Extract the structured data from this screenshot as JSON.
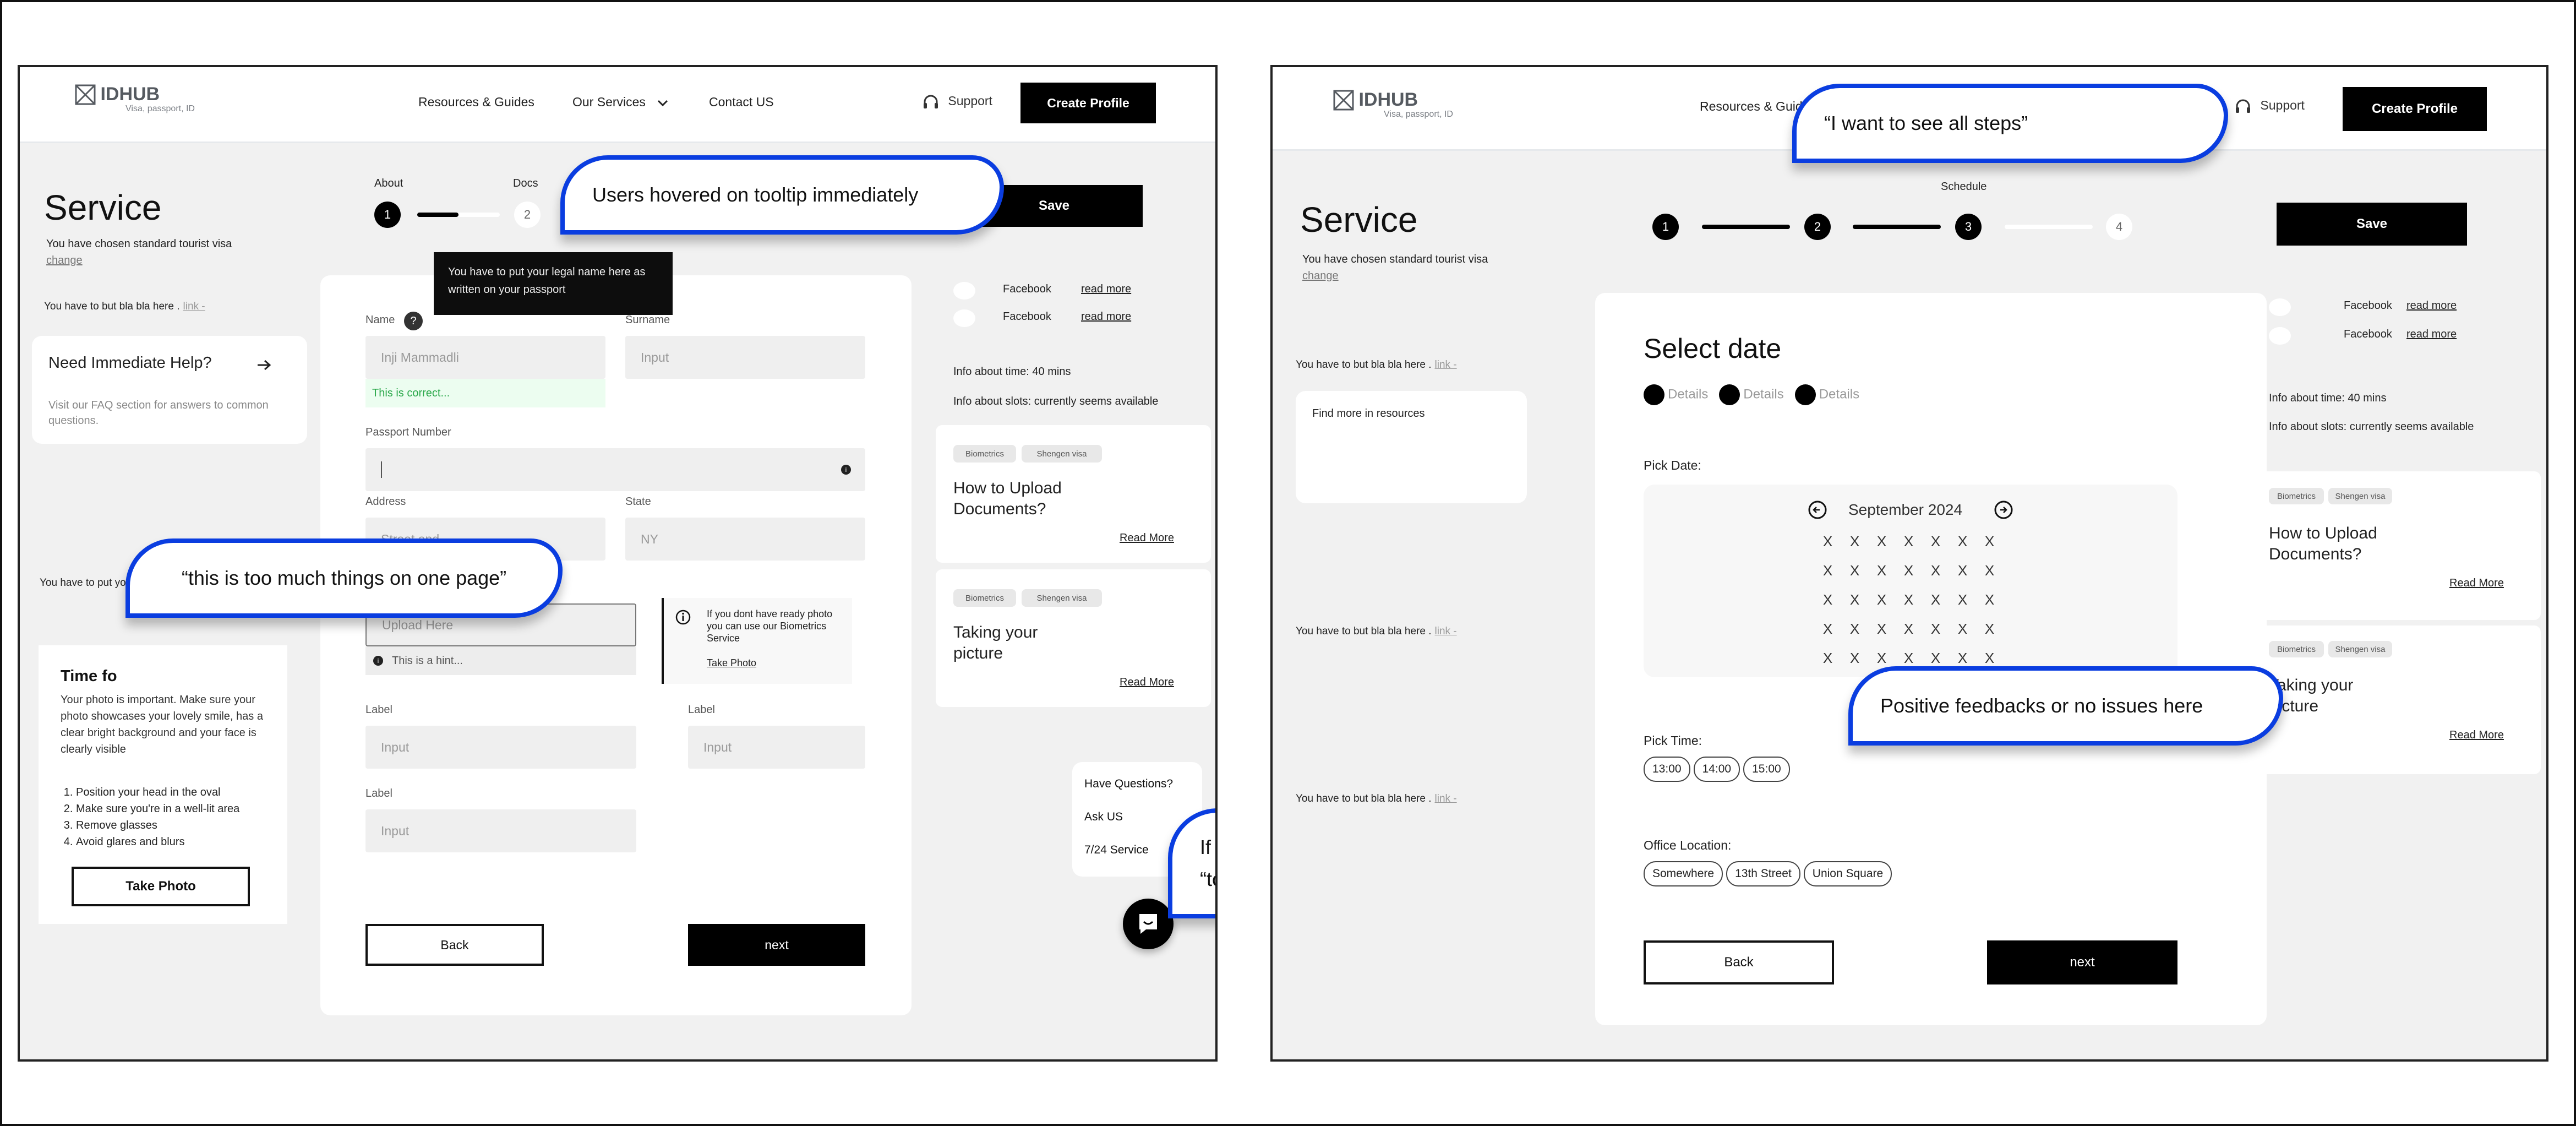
{
  "left_screen": {
    "logo": {
      "brand": "IDHUB",
      "tagline": "Visa, passport, ID",
      "icon": "box-x-icon"
    },
    "nav": {
      "items": [
        "Resources & Guides",
        "Our Services",
        "Contact US"
      ],
      "support_label": "Support",
      "create_profile_label": "Create Profile"
    },
    "service": {
      "title": "Service",
      "subtitle": "You have chosen standard tourist visa",
      "change_link": "change"
    },
    "stepper": {
      "steps": [
        {
          "number": "1",
          "label": "About",
          "state": "done"
        },
        {
          "number": "2",
          "label": "Docs",
          "state": "todo"
        }
      ],
      "progress_to_next": 0.5
    },
    "save_label": "Save",
    "sidebar": {
      "hint_1": "You have to but bla bla here .",
      "hint_1_link": "link -",
      "help_card": {
        "title": "Need Immediate Help?",
        "description": "Visit our FAQ section for answers to common questions."
      },
      "address_hint": "You have to put your address where you live",
      "photo_card": {
        "title": "Time fo",
        "description": "Your photo is important. Make sure your photo showcases your lovely smile, has a clear bright background and your face is clearly visible",
        "steps": [
          "Position your head in the oval",
          "Make sure you're in a well-lit area",
          "Remove glasses",
          "Avoid glares and blurs"
        ],
        "button_label": "Take Photo"
      }
    },
    "tooltip": "You have to put your legal name here as written on your passport",
    "form": {
      "name_label": "Name",
      "name_value": "Inji Mammadli",
      "name_success": "This is correct...",
      "surname_label": "Surname",
      "surname_placeholder": "Input",
      "passport_label": "Passport Number",
      "passport_value": "",
      "address_label": "Address",
      "address_placeholder": "Street and...",
      "state_label": "State",
      "state_value": "NY",
      "upload_placeholder": "Upload Here",
      "upload_hint": "This is a hint...",
      "biometrics_note": "If you dont have ready photo you can use our Biometrics Service",
      "biometrics_link": "Take Photo",
      "extra_fields": [
        {
          "label": "Label",
          "placeholder": "Input"
        },
        {
          "label": "Label",
          "placeholder": "Input"
        },
        {
          "label": "Label",
          "placeholder": "Input"
        }
      ],
      "back_label": "Back",
      "next_label": "next"
    },
    "right_panel": {
      "social": [
        {
          "name": "Facebook",
          "link": "read more"
        },
        {
          "name": "Facebook",
          "link": "read more"
        }
      ],
      "info_time": "Info about time: 40 mins",
      "info_slots": "Info about slots: currently seems available",
      "articles": [
        {
          "tags": [
            "Biometrics",
            "Shengen visa"
          ],
          "title": "How to Upload Documents?",
          "link": "Read More"
        },
        {
          "tags": [
            "Biometrics",
            "Shengen visa"
          ],
          "title": "Taking your picture",
          "link": "Read More"
        }
      ],
      "questions": [
        "Have Questions?",
        "Ask US",
        "7/24 Service"
      ]
    },
    "callouts": {
      "tooltip_feedback": "Users hovered on tooltip immediately",
      "too_much": "“this is too much things on one page”",
      "chat_feedback": "If user was stuck they used this after “tooltip”"
    }
  },
  "right_screen": {
    "logo": {
      "brand": "IDHUB",
      "tagline": "Visa, passport, ID",
      "icon": "box-x-icon"
    },
    "nav": {
      "items": [
        "Resources & Guides"
      ],
      "support_label": "Support",
      "create_profile_label": "Create Profile"
    },
    "service": {
      "title": "Service",
      "subtitle": "You have chosen standard tourist visa",
      "change_link": "change"
    },
    "stepper": {
      "current_label": "Schedule",
      "steps": [
        {
          "number": "1",
          "state": "done"
        },
        {
          "number": "2",
          "state": "done"
        },
        {
          "number": "3",
          "state": "done"
        },
        {
          "number": "4",
          "state": "todo"
        }
      ]
    },
    "save_label": "Save",
    "sidebar": {
      "hints": [
        {
          "text": "You have to but bla bla here .",
          "link": "link -"
        },
        {
          "text": "You have to but bla bla here .",
          "link": "link -"
        },
        {
          "text": "You have to but bla bla here .",
          "link": "link -"
        }
      ],
      "resources_card": "Find more in resources"
    },
    "select_date": {
      "title": "Select date",
      "substeps": [
        "Details",
        "Details",
        "Details"
      ],
      "pick_date_label": "Pick Date:",
      "month": "September 2024",
      "calendar_rows": 5,
      "calendar_cols": 7,
      "calendar_cell": "X",
      "pick_time_label": "Pick Time:",
      "times": [
        "13:00",
        "14:00",
        "15:00"
      ],
      "office_label": "Office Location:",
      "offices": [
        "Somewhere",
        "13th Street",
        "Union Square"
      ],
      "back_label": "Back",
      "next_label": "next"
    },
    "right_panel": {
      "social": [
        {
          "name": "Facebook",
          "link": "read more"
        },
        {
          "name": "Facebook",
          "link": "read more"
        }
      ],
      "info_time": "Info about time: 40 mins",
      "info_slots": "Info about slots: currently seems available",
      "articles": [
        {
          "tags": [
            "Biometrics",
            "Shengen visa"
          ],
          "title": "How to Upload Documents?",
          "link": "Read More"
        },
        {
          "tags": [
            "Biometrics",
            "Shengen visa"
          ],
          "title": "Taking your picture",
          "link": "Read More"
        }
      ]
    },
    "callouts": {
      "all_steps": "“I want to see all steps”",
      "positive": "Positive feedbacks or no issues here"
    }
  }
}
